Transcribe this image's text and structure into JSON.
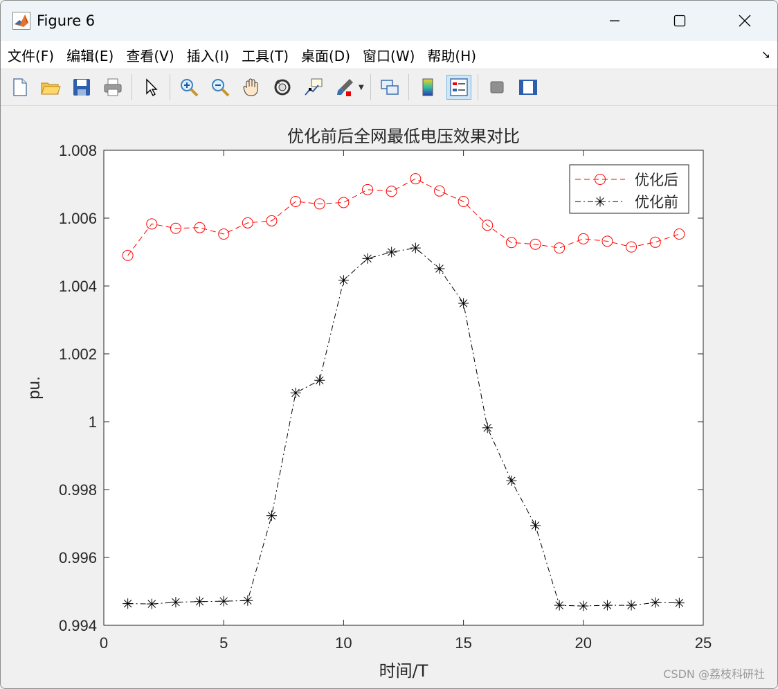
{
  "window": {
    "title": "Figure 6",
    "controls": [
      "minimize",
      "maximize",
      "close"
    ]
  },
  "menu": {
    "items": [
      "文件(F)",
      "编辑(E)",
      "查看(V)",
      "插入(I)",
      "工具(T)",
      "桌面(D)",
      "窗口(W)",
      "帮助(H)"
    ],
    "overflow": "↘"
  },
  "toolbar": {
    "buttons": [
      {
        "icon": "new-figure-icon"
      },
      {
        "icon": "open-file-icon"
      },
      {
        "icon": "save-icon"
      },
      {
        "icon": "print-icon"
      },
      {
        "icon": "pointer-icon"
      },
      {
        "icon": "zoom-in-icon"
      },
      {
        "icon": "zoom-out-icon"
      },
      {
        "icon": "pan-hand-icon"
      },
      {
        "icon": "rotate-3d-icon"
      },
      {
        "icon": "data-cursor-icon"
      },
      {
        "icon": "brush-icon"
      },
      {
        "icon": "link-plot-icon"
      },
      {
        "icon": "colorbar-icon"
      },
      {
        "icon": "legend-icon"
      },
      {
        "icon": "hide-plot-tools-icon"
      },
      {
        "icon": "show-plot-tools-icon"
      }
    ]
  },
  "watermark": "CSDN @荔枝科研社",
  "chart_data": {
    "type": "line",
    "title": "优化前后全网最低电压效果对比",
    "xlabel": "时间/T",
    "ylabel": "pu.",
    "xlim": [
      0,
      25
    ],
    "ylim": [
      0.994,
      1.008
    ],
    "xticks": [
      "0",
      "5",
      "10",
      "15",
      "20",
      "25"
    ],
    "yticks": [
      "0.994",
      "0.996",
      "0.998",
      "1",
      "1.002",
      "1.004",
      "1.006",
      "1.008"
    ],
    "legend_position": "top-right",
    "grid": false,
    "x": [
      1,
      2,
      3,
      4,
      5,
      6,
      7,
      8,
      9,
      10,
      11,
      12,
      13,
      14,
      15,
      16,
      17,
      18,
      19,
      20,
      21,
      22,
      23,
      24
    ],
    "series": [
      {
        "name": "优化后",
        "color": "#ff0000",
        "line": "dashed",
        "marker": "circle",
        "values": [
          1.0049,
          1.00583,
          1.0057,
          1.00572,
          1.00553,
          1.00586,
          1.00592,
          1.00649,
          1.00642,
          1.00646,
          1.00684,
          1.00679,
          1.00716,
          1.0068,
          1.00649,
          1.00579,
          1.00528,
          1.00523,
          1.00512,
          1.00539,
          1.00532,
          1.00515,
          1.00529,
          1.00553
        ]
      },
      {
        "name": "优化前",
        "color": "#000000",
        "line": "dashdot",
        "marker": "star",
        "values": [
          0.99464,
          0.99463,
          0.99468,
          0.9947,
          0.99471,
          0.99473,
          0.99723,
          1.00085,
          1.00122,
          1.00417,
          1.00481,
          1.005,
          1.00512,
          1.00451,
          1.00349,
          0.99982,
          0.99826,
          0.99694,
          0.99459,
          0.99457,
          0.99459,
          0.99459,
          0.99467,
          0.99466
        ]
      }
    ]
  }
}
